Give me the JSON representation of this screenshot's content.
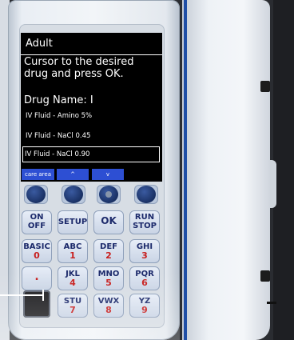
{
  "screen": {
    "title": "Adult",
    "instruction": "Cursor to the desired drug and press OK.",
    "drug_name_label": "Drug Name: I",
    "drugs": [
      {
        "label": "IV Fluid - Amino 5%",
        "selected": false
      },
      {
        "label": "IV Fluid - NaCl 0.45",
        "selected": false
      },
      {
        "label": "IV Fluid - NaCl 0.90",
        "selected": true
      }
    ],
    "softkeys": {
      "care_area": "care area",
      "up": "^",
      "down": "v",
      "blank": ""
    }
  },
  "keys": {
    "on_off": {
      "line1": "ON",
      "line2": "OFF"
    },
    "setup": "SETUP",
    "ok": "OK",
    "run_stop": {
      "line1": "RUN",
      "line2": "STOP"
    },
    "k0": {
      "letters": "BASIC",
      "digit": "0"
    },
    "k1": {
      "letters": "ABC",
      "digit": "1"
    },
    "k2": {
      "letters": "DEF",
      "digit": "2"
    },
    "k3": {
      "letters": "GHI",
      "digit": "3"
    },
    "k_dot": ".",
    "k4": {
      "letters": "JKL",
      "digit": "4"
    },
    "k5": {
      "letters": "MNO",
      "digit": "5"
    },
    "k6": {
      "letters": "PQR",
      "digit": "6"
    },
    "k7": {
      "letters": "STU",
      "digit": "7"
    },
    "k8": {
      "letters": "VWX",
      "digit": "8"
    },
    "k9": {
      "letters": "YZ",
      "digit": "9"
    }
  },
  "colors": {
    "screen_bg": "#000000",
    "softkey_blue": "#2d4fd3",
    "key_text": "#1c2a6b",
    "digit_red": "#c8201f",
    "rail_blue": "#1f4ea6"
  }
}
